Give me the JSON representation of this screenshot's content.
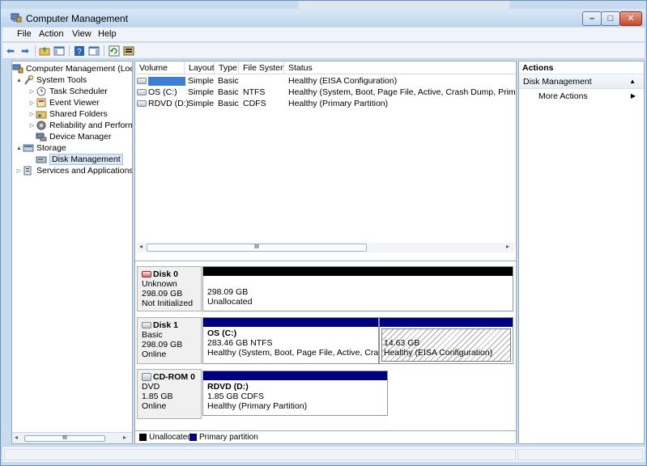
{
  "window": {
    "title": "Computer Management"
  },
  "menu": [
    "File",
    "Action",
    "View",
    "Help"
  ],
  "tree": {
    "items": [
      {
        "label": "Computer Management (Local",
        "level": 0,
        "expander": "",
        "icon": "computer-management-icon"
      },
      {
        "label": "System Tools",
        "level": 1,
        "expander": "▲",
        "icon": "tools-icon"
      },
      {
        "label": "Task Scheduler",
        "level": 2,
        "expander": "▷",
        "icon": "clock-icon"
      },
      {
        "label": "Event Viewer",
        "level": 2,
        "expander": "▷",
        "icon": "event-viewer-icon"
      },
      {
        "label": "Shared Folders",
        "level": 2,
        "expander": "▷",
        "icon": "shared-folder-icon"
      },
      {
        "label": "Reliability and Performa",
        "level": 2,
        "expander": "▷",
        "icon": "performance-icon"
      },
      {
        "label": "Device Manager",
        "level": 2,
        "expander": "",
        "icon": "device-manager-icon"
      },
      {
        "label": "Storage",
        "level": 1,
        "expander": "▲",
        "icon": "storage-icon"
      },
      {
        "label": "Disk Management",
        "level": 2,
        "expander": "",
        "icon": "disk-management-icon",
        "selected": true
      },
      {
        "label": "Services and Applications",
        "level": 1,
        "expander": "▷",
        "icon": "services-icon"
      }
    ],
    "scroll_thumb": "III"
  },
  "volume_list": {
    "columns": [
      "Volume",
      "Layout",
      "Type",
      "File System",
      "Status"
    ],
    "rows": [
      {
        "volume": "",
        "layout": "Simple",
        "type": "Basic",
        "fs": "",
        "status": "Healthy (EISA Configuration)"
      },
      {
        "volume": "OS (C:)",
        "layout": "Simple",
        "type": "Basic",
        "fs": "NTFS",
        "status": "Healthy (System, Boot, Page File, Active, Crash Dump, Primary Parti"
      },
      {
        "volume": "RDVD (D:)",
        "layout": "Simple",
        "type": "Basic",
        "fs": "CDFS",
        "status": "Healthy (Primary Partition)"
      }
    ],
    "scroll_thumb": "III"
  },
  "disks": [
    {
      "name": "Disk 0",
      "kind": "Unknown",
      "size": "298.09 GB",
      "state": "Not Initialized",
      "partitions": [
        {
          "line1": "",
          "line2": "298.09 GB",
          "line3": "Unallocated",
          "color": "#000000"
        }
      ]
    },
    {
      "name": "Disk 1",
      "kind": "Basic",
      "size": "298.09 GB",
      "state": "Online",
      "partitions": [
        {
          "line1": "OS  (C:)",
          "line2": "283.46 GB NTFS",
          "line3": "Healthy (System, Boot, Page File, Active, Crash Du",
          "color": "#00007f"
        },
        {
          "line1": "",
          "line2": "14.63 GB",
          "line3": "Healthy (EISA Configuration)",
          "color": "#00007f"
        }
      ]
    },
    {
      "name": "CD-ROM 0",
      "kind": "DVD",
      "size": "1.85 GB",
      "state": "Online",
      "partitions": [
        {
          "line1": "RDVD  (D:)",
          "line2": "1.85 GB CDFS",
          "line3": "Healthy (Primary Partition)",
          "color": "#00007f"
        }
      ]
    }
  ],
  "legend": [
    {
      "label": "Unallocated",
      "color": "#000000"
    },
    {
      "label": "Primary partition",
      "color": "#00007f"
    }
  ],
  "actions": {
    "header": "Actions",
    "section": "Disk Management",
    "more": "More Actions"
  }
}
